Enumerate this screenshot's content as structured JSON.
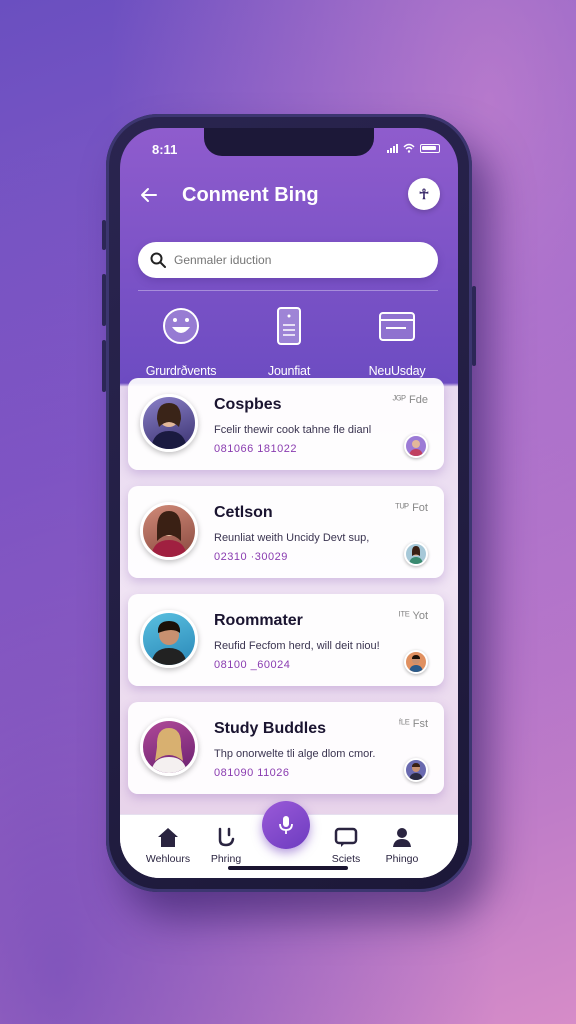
{
  "status_bar": {
    "time": "8:11"
  },
  "header": {
    "title": "Conment Bing",
    "action_label": "☥"
  },
  "search": {
    "placeholder": "Genmaler iduction"
  },
  "quick_actions": [
    {
      "label": "Grurdrðvents",
      "icon": "face-icon"
    },
    {
      "label": "Jounfiat",
      "icon": "document-icon"
    },
    {
      "label": "NeuUsday",
      "icon": "calendar-icon"
    }
  ],
  "groups": [
    {
      "name": "Cospbes",
      "message": "Fcelir thewir cook tahne fle dianl",
      "number": "081066 181022",
      "meta": "ᴶᴳᴾ Fde",
      "avatar_color": "#5a4c9a",
      "mini_color": "#9c7bd6"
    },
    {
      "name": "Cetlson",
      "message": "Reunliat weith Uncidy Devt sup,",
      "number": "02310 ·30029",
      "meta": "ᵀᵁᴾ Fot",
      "avatar_color": "#c07a6a",
      "mini_color": "#a6c8d8"
    },
    {
      "name": "Roommater",
      "message": "Reufid Fecfom herd, will deit niou!",
      "number": "08100 _60024",
      "meta": "ᴵᵀᴱ Yot",
      "avatar_color": "#3aa6d0",
      "mini_color": "#e09060"
    },
    {
      "name": "Study Buddles",
      "message": "Thp onorwelte tli alge dlom cmor.",
      "number": "081090 11026",
      "meta": "ᶠᴸᴱ Fst",
      "avatar_color": "#8a3c8c",
      "mini_color": "#6a6ab0"
    }
  ],
  "tabs": [
    {
      "label": "Wehlours",
      "icon": "home-icon"
    },
    {
      "label": "Phring",
      "icon": "phone-icon"
    },
    {
      "label": "",
      "icon": "microphone-icon"
    },
    {
      "label": "Sciets",
      "icon": "chat-icon"
    },
    {
      "label": "Phingo",
      "icon": "profile-icon"
    }
  ],
  "colors": {
    "accent": "#7b4cc8",
    "number_text": "#8a3cb0"
  }
}
